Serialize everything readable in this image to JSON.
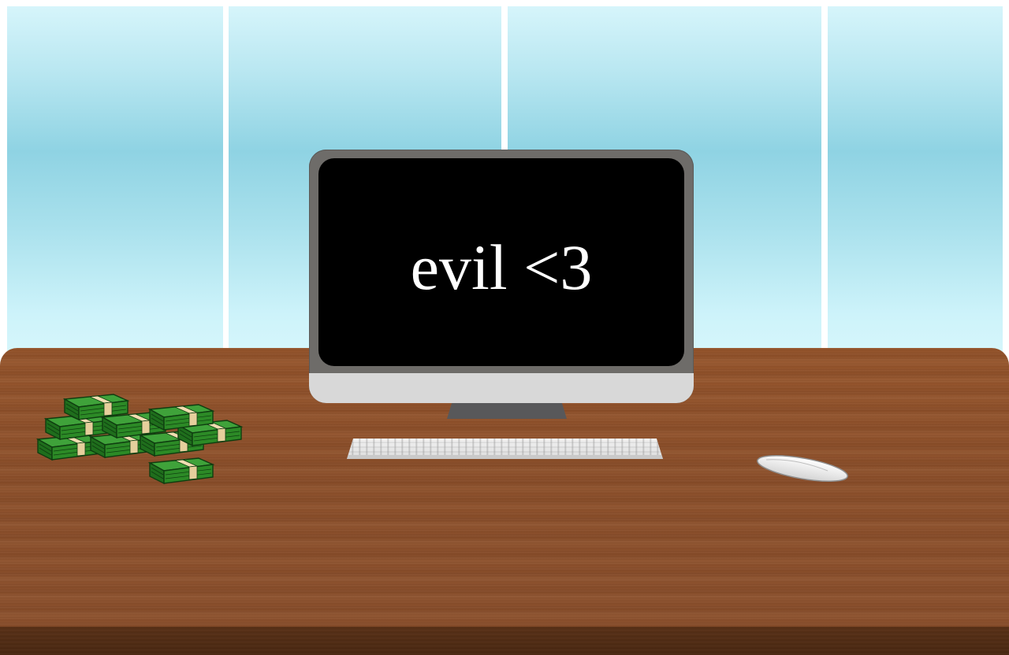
{
  "screen": {
    "text": "evil <3"
  },
  "colors": {
    "sky": "#9ad9e8",
    "window_frame": "#ffffff",
    "desk_wood": "#8c4f2a",
    "desk_edge": "#4b2912",
    "monitor_bezel": "#6e6c69",
    "monitor_chin": "#d8d8d8",
    "screen": "#000000",
    "money_green": "#2a8a22",
    "money_band": "#f0ddb0"
  },
  "icons": [
    "window-pane",
    "desk",
    "monitor",
    "keyboard",
    "mouse-icon",
    "money-stack-icon"
  ]
}
